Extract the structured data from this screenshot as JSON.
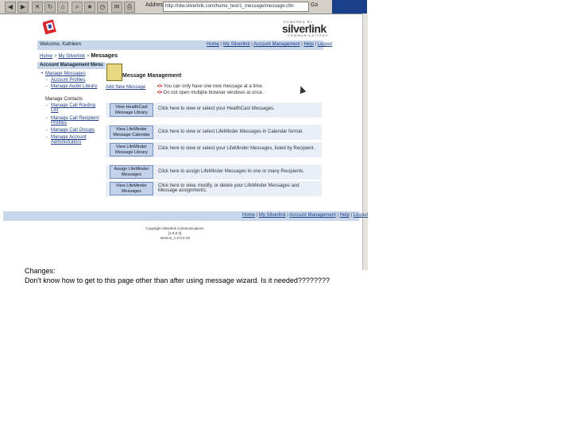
{
  "browser": {
    "address_label": "Address",
    "address_value": "http://rdw.silverlink.com/home_test/1_message/message.cfm",
    "go_label": "Go"
  },
  "header": {
    "powered_by": "POWERED BY",
    "brand": "silverlink",
    "brand_sub": "COMMUNICATIONS",
    "welcome": "Welcome, Kathleen",
    "nav": [
      "Home",
      "My Silverlink",
      "Account Management",
      "Help",
      "Logout"
    ]
  },
  "breadcrumb": {
    "home": "Home",
    "my": "My Silverlink",
    "current": "Messages"
  },
  "sidebar": {
    "title": "Account Management Menu",
    "sections": [
      {
        "heading": "Manage Messages",
        "items": [
          "Account Profiles",
          "Manage Audio Library"
        ]
      },
      {
        "heading": "Manage Contacts",
        "items": [
          "Manage Call Routing List",
          "Manage Call Recipient Profiles",
          "Manage Call Groups",
          "Manage Account Administrators"
        ]
      }
    ]
  },
  "main": {
    "title": "Message Management",
    "add_new": "Add New Message",
    "notes": [
      "You can only have one new message at a time.",
      "Do not open multiple browser windows at once."
    ],
    "rows": [
      {
        "button": "View HealthCast Message Library",
        "desc": "Click here to view or select your HealthCast Messages."
      },
      {
        "button": "View LifeMinder Message Calendar",
        "desc": "Click here to view or select LifeMinder Messages in Calendar format."
      },
      {
        "button": "View LifeMinder Message Library",
        "desc": "Click here to view or select your LifeMinder Messages, listed by Recipient."
      },
      {
        "button": "Assign LifeMinder Messages",
        "desc": "Click here to assign LifeMinder Messages to one or many Recipients."
      },
      {
        "button": "View LifeMinder Messages",
        "desc": "Click here to view, modify, or delete your LifeMinder Messages and Message assignments."
      }
    ]
  },
  "footer": {
    "nav": [
      "Home",
      "My Silverlink",
      "Account Management",
      "Help",
      "Logout"
    ],
    "copyright": [
      "Copyright Silverlink Communications",
      "[1.0.0.3]",
      "Version_1.0.0.0.19"
    ]
  },
  "caption": {
    "label": "Changes:",
    "text": "Don't know how to get to this page other than after using message wizard.  Is it needed????????"
  }
}
